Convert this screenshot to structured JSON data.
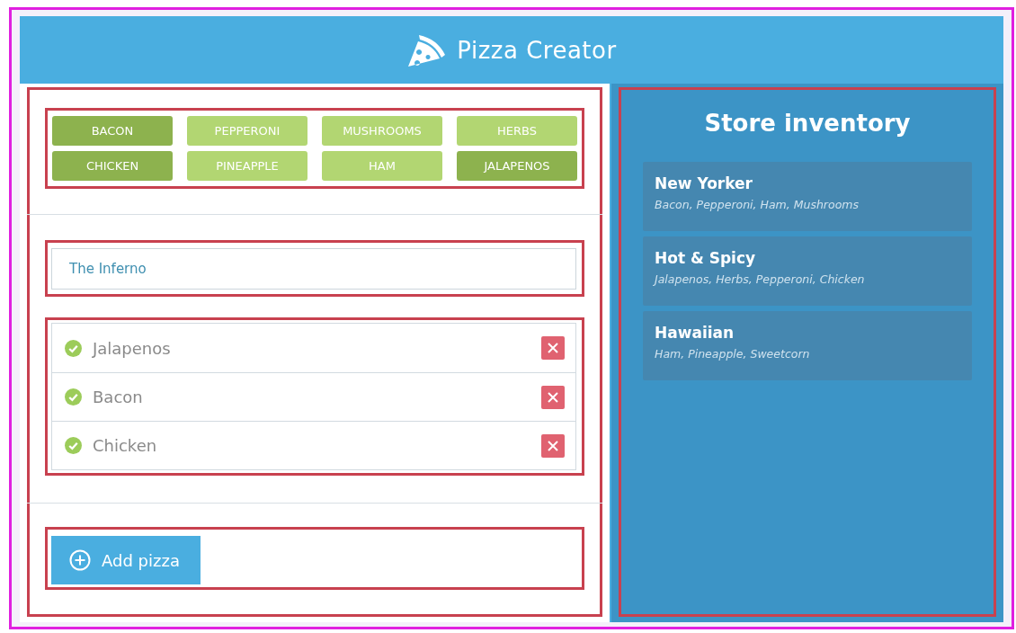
{
  "header": {
    "title": "Pizza Creator"
  },
  "toppings": [
    {
      "label": "BACON",
      "selected": true
    },
    {
      "label": "PEPPERONI",
      "selected": false
    },
    {
      "label": "MUSHROOMS",
      "selected": false
    },
    {
      "label": "HERBS",
      "selected": false
    },
    {
      "label": "CHICKEN",
      "selected": true
    },
    {
      "label": "PINEAPPLE",
      "selected": false
    },
    {
      "label": "HAM",
      "selected": false
    },
    {
      "label": "JALAPENOS",
      "selected": true
    }
  ],
  "name_field": {
    "value": "The Inferno"
  },
  "selected_toppings": [
    {
      "label": "Jalapenos"
    },
    {
      "label": "Bacon"
    },
    {
      "label": "Chicken"
    }
  ],
  "add_button": {
    "label": "Add pizza"
  },
  "inventory": {
    "title": "Store inventory",
    "pizzas": [
      {
        "name": "New Yorker",
        "toppings": "Bacon, Pepperoni, Ham, Mushrooms"
      },
      {
        "name": "Hot & Spicy",
        "toppings": "Jalapenos, Herbs, Pepperoni, Chicken"
      },
      {
        "name": "Hawaiian",
        "toppings": "Ham, Pineapple, Sweetcorn"
      }
    ]
  }
}
